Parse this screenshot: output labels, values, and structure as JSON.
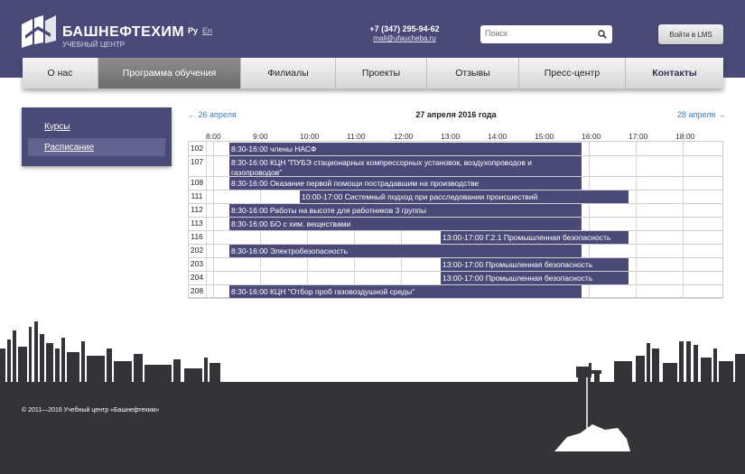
{
  "header": {
    "brand": "БАШНЕФТЕХИМ",
    "brand_sub": "УЧЕБНЫЙ ЦЕНТР",
    "lang_ru": "Ру",
    "lang_en": "En",
    "phone": "+7 (347) 295-94-62",
    "email": "mail@ufaucheba.ru",
    "search_placeholder": "Поиск",
    "login_label": "Войти в LMS",
    "accent_color": "#4a4a78"
  },
  "nav": {
    "items": [
      {
        "label": "О нас"
      },
      {
        "label": "Программа обучения"
      },
      {
        "label": "Филиалы"
      },
      {
        "label": "Проекты"
      },
      {
        "label": "Отзывы"
      },
      {
        "label": "Пресс-центр"
      },
      {
        "label": "Контакты"
      }
    ],
    "active_index": 1
  },
  "sidebar": {
    "items": [
      {
        "label": "Курсы"
      },
      {
        "label": "Расписание"
      }
    ],
    "active_index": 1
  },
  "schedule": {
    "prev_label": "← 26 апреля",
    "next_label": "28 апреля →",
    "title": "27 апреля 2016 года",
    "hours": [
      "8:00",
      "9:00",
      "10:00",
      "11:00",
      "12:00",
      "13:00",
      "14:00",
      "15:00",
      "16:00",
      "17:00",
      "18:00"
    ],
    "rows": [
      {
        "room": "102",
        "text": "8:30-16:00 члены НАСФ",
        "start": 8.5,
        "end": 16
      },
      {
        "room": "107",
        "text": "8:30-16:00 КЦН \"ПУБЭ стационарных компрессорных установок, воздухопроводов и газопроводов\"",
        "start": 8.5,
        "end": 16
      },
      {
        "room": "108",
        "text": "8:30-16:00 Оказание первой помощи пострадавшим на производстве",
        "start": 8.5,
        "end": 16
      },
      {
        "room": "111",
        "text": "10:00-17:00 Системный подход при расследовании происшествий",
        "start": 10,
        "end": 17
      },
      {
        "room": "112",
        "text": "8:30-16:00 Работы на высоте для работников 3 группы",
        "start": 8.5,
        "end": 16
      },
      {
        "room": "113",
        "text": "8:30-16:00 БО с хим. веществами",
        "start": 8.5,
        "end": 16
      },
      {
        "room": "116",
        "text": "13:00-17:00 Г.2.1 Промышленная безопасность",
        "start": 13,
        "end": 17
      },
      {
        "room": "202",
        "text": "8:30-16:00 Электробезопасность",
        "start": 8.5,
        "end": 16
      },
      {
        "room": "203",
        "text": "13:00-17:00 Промышленная безопасность",
        "start": 13,
        "end": 17
      },
      {
        "room": "204",
        "text": "13:00-17:00 Промышленная безопасность",
        "start": 13,
        "end": 17
      },
      {
        "room": "208",
        "text": "8:30-16:00 КЦН \"Отбор проб газовоздушной среды\"",
        "start": 8.5,
        "end": 16
      }
    ]
  },
  "footer": {
    "copyright": "© 2011—2016 Учебный центр «Башнефтехим»"
  }
}
